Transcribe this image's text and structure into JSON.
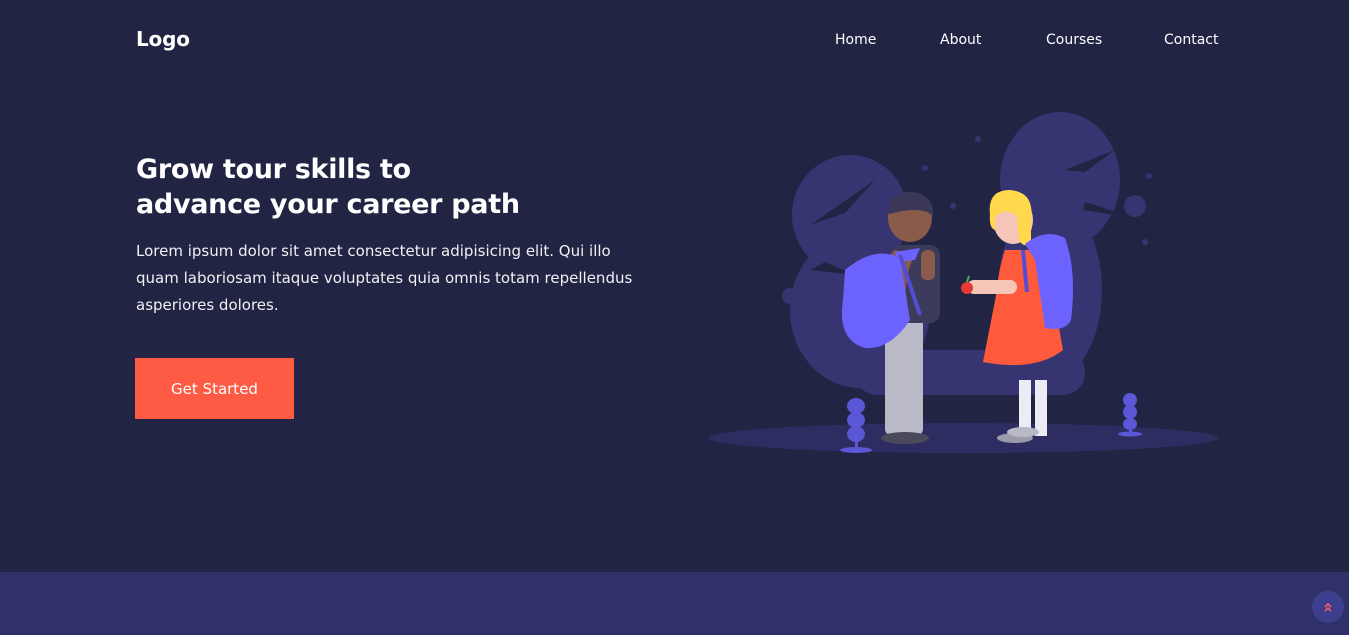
{
  "header": {
    "logo": "Logo",
    "nav": [
      {
        "label": "Home"
      },
      {
        "label": "About"
      },
      {
        "label": "Courses"
      },
      {
        "label": "Contact"
      }
    ]
  },
  "hero": {
    "title_line1": "Grow tour skills to",
    "title_line2": "advance your career path",
    "description": "Lorem ipsum dolor sit amet consectetur adipisicing elit. Qui illo quam laboriosam itaque voluptates quia omnis totam repellendus asperiores dolores.",
    "cta_label": "Get Started"
  },
  "illustration": {
    "icon": "students-with-backpacks-illustration"
  },
  "scroll_top": {
    "icon": "double-chevron-up-icon"
  },
  "colors": {
    "background": "#212442",
    "accent": "#fd5b44",
    "footer_band": "#30306a",
    "illustration_purple": "#6c63ff"
  }
}
